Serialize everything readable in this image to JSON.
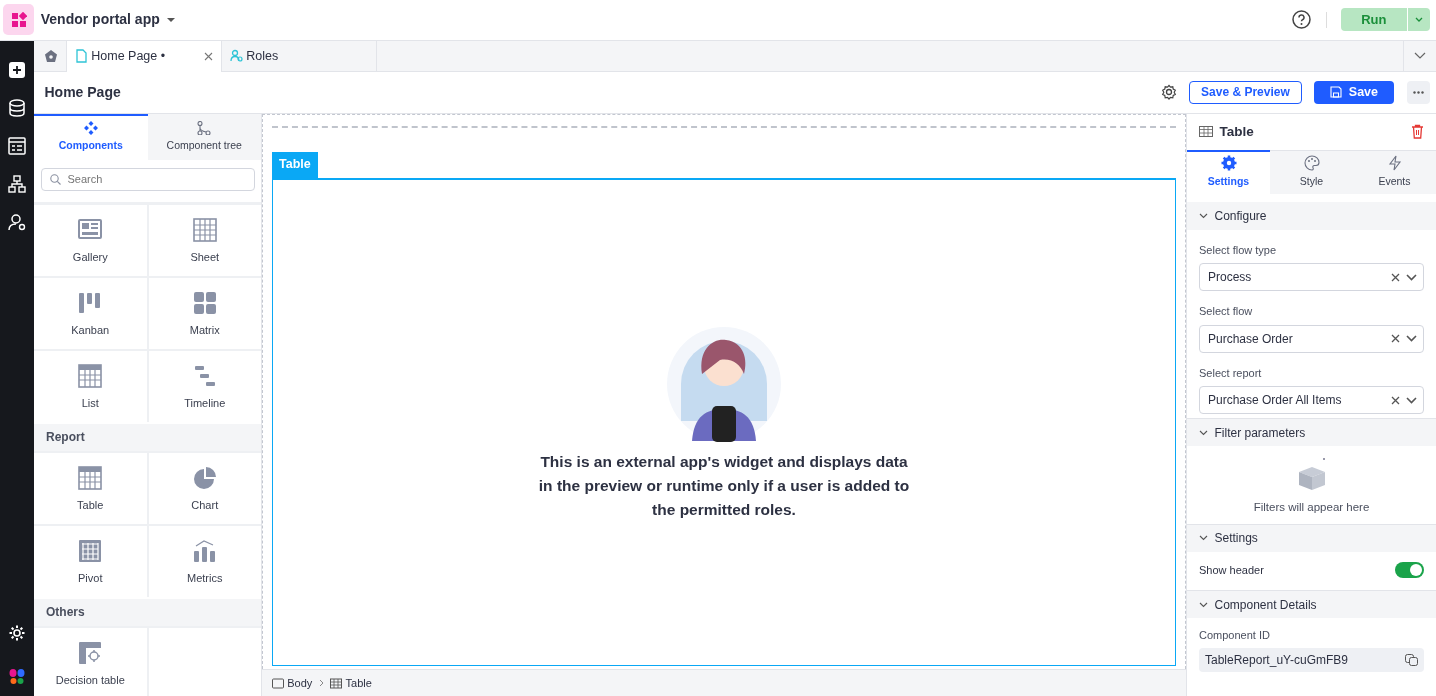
{
  "app": {
    "name": "Vendor portal app",
    "run_label": "Run"
  },
  "tabs": [
    {
      "label": "Home Page •",
      "selected": true,
      "closable": true,
      "kind": "page"
    },
    {
      "label": "Roles",
      "selected": false,
      "closable": false,
      "kind": "roles"
    }
  ],
  "page": {
    "title": "Home Page",
    "buttons": [
      {
        "label": "Save & Preview",
        "kind": "outline"
      },
      {
        "label": "Save",
        "kind": "primary"
      }
    ]
  },
  "left_panel": {
    "tabs": [
      {
        "label": "Components",
        "selected": true,
        "kind": "components"
      },
      {
        "label": "Component tree",
        "selected": false,
        "kind": "tree"
      }
    ],
    "search": {
      "placeholder": "Search"
    },
    "groups": [
      {
        "items": [
          {
            "label": "Gallery",
            "kind": "gallery"
          },
          {
            "label": "Sheet",
            "kind": "sheet"
          },
          {
            "label": "Kanban",
            "kind": "kanban"
          },
          {
            "label": "Matrix",
            "kind": "matrix"
          },
          {
            "label": "List",
            "kind": "list"
          },
          {
            "label": "Timeline",
            "kind": "timeline"
          }
        ]
      },
      {
        "title": "Report",
        "items": [
          {
            "label": "Table",
            "kind": "table"
          },
          {
            "label": "Chart",
            "kind": "chart"
          },
          {
            "label": "Pivot",
            "kind": "pivot"
          },
          {
            "label": "Metrics",
            "kind": "metrics"
          }
        ]
      },
      {
        "title": "Others",
        "items": [
          {
            "label": "Decision table",
            "kind": "decision"
          }
        ]
      }
    ]
  },
  "canvas": {
    "widget_label": "Table",
    "message": "This is an external app's widget and displays data in the preview or runtime only if a user is added to the permitted roles."
  },
  "breadcrumb": [
    {
      "label": "Body",
      "kind": "body"
    },
    {
      "label": "Table",
      "kind": "table"
    }
  ],
  "properties": {
    "title": "Table",
    "tabs": [
      {
        "label": "Settings",
        "selected": true,
        "kind": "settings"
      },
      {
        "label": "Style",
        "selected": false,
        "kind": "style"
      },
      {
        "label": "Events",
        "selected": false,
        "kind": "events"
      }
    ],
    "sections": [
      {
        "title": "Configure",
        "expanded": true,
        "fields": [
          {
            "kind": "select",
            "label": "Select flow type",
            "value": "Process"
          },
          {
            "kind": "select",
            "label": "Select flow",
            "value": "Purchase Order"
          },
          {
            "kind": "select",
            "label": "Select report",
            "value": "Purchase Order All Items"
          }
        ]
      },
      {
        "title": "Filter parameters",
        "expanded": true,
        "empty_text": "Filters will appear here"
      },
      {
        "title": "Settings",
        "expanded": true,
        "fields": [
          {
            "kind": "toggle",
            "label": "Show header",
            "on": true
          }
        ]
      },
      {
        "title": "Component Details",
        "expanded": true,
        "fields": [
          {
            "kind": "copy",
            "label": "Component ID",
            "value": "TableReport_uY-cuGmFB9"
          }
        ]
      }
    ]
  }
}
